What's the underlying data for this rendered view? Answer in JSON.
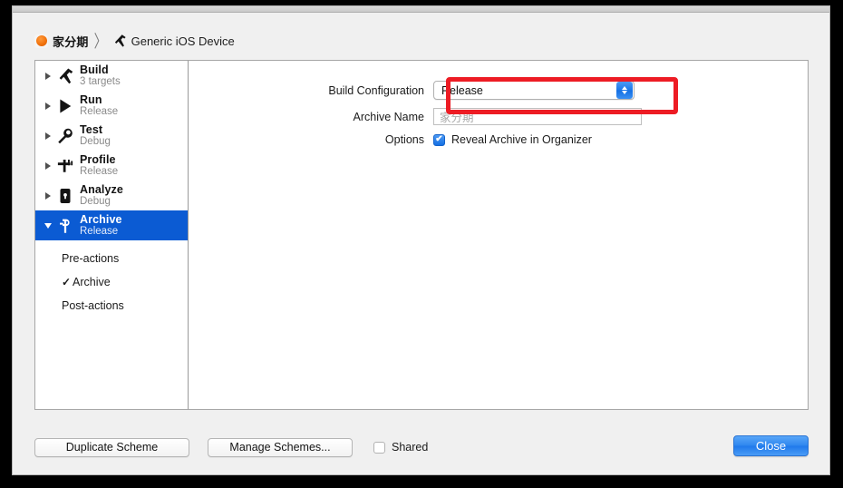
{
  "window": {
    "breadcrumb": {
      "app_icon": "app-circle-icon",
      "project_name": "家分期",
      "separator": "〉",
      "target_icon": "hammer-icon",
      "device_name": "Generic iOS Device"
    }
  },
  "sidebar": {
    "items": [
      {
        "label": "Build",
        "sub": "3 targets",
        "icon": "hammer-icon",
        "expanded": false,
        "selected": false
      },
      {
        "label": "Run",
        "sub": "Release",
        "icon": "play-icon",
        "expanded": false,
        "selected": false
      },
      {
        "label": "Test",
        "sub": "Debug",
        "icon": "wrench-icon",
        "expanded": false,
        "selected": false
      },
      {
        "label": "Profile",
        "sub": "Release",
        "icon": "caliper-icon",
        "expanded": false,
        "selected": false
      },
      {
        "label": "Analyze",
        "sub": "Debug",
        "icon": "lock-icon",
        "expanded": false,
        "selected": false
      },
      {
        "label": "Archive",
        "sub": "Release",
        "icon": "archive-icon",
        "expanded": true,
        "selected": true
      }
    ],
    "children": [
      {
        "label": "Pre-actions",
        "checked": false
      },
      {
        "label": "Archive",
        "checked": true,
        "check_glyph": "✓"
      },
      {
        "label": "Post-actions",
        "checked": false
      }
    ]
  },
  "form": {
    "build_configuration": {
      "label": "Build Configuration",
      "value": "Release",
      "stepper_icon": "up-down-chevron-icon",
      "highlighted": true,
      "highlight_color": "#ed1c24"
    },
    "archive_name": {
      "label": "Archive Name",
      "value": "",
      "placeholder": "家分期"
    },
    "options": {
      "label": "Options",
      "checkbox_label": "Reveal Archive in Organizer",
      "checked": true,
      "check_glyph": "✔"
    }
  },
  "footer": {
    "duplicate_scheme": "Duplicate Scheme",
    "manage_schemes": "Manage Schemes...",
    "shared_label": "Shared",
    "shared_checked": false,
    "close": "Close"
  },
  "colors": {
    "selection_blue": "#0b5bd3",
    "accent_blue": "#1f79eb",
    "annotation_red": "#ed1c24",
    "app_orange": "#f2730d"
  }
}
